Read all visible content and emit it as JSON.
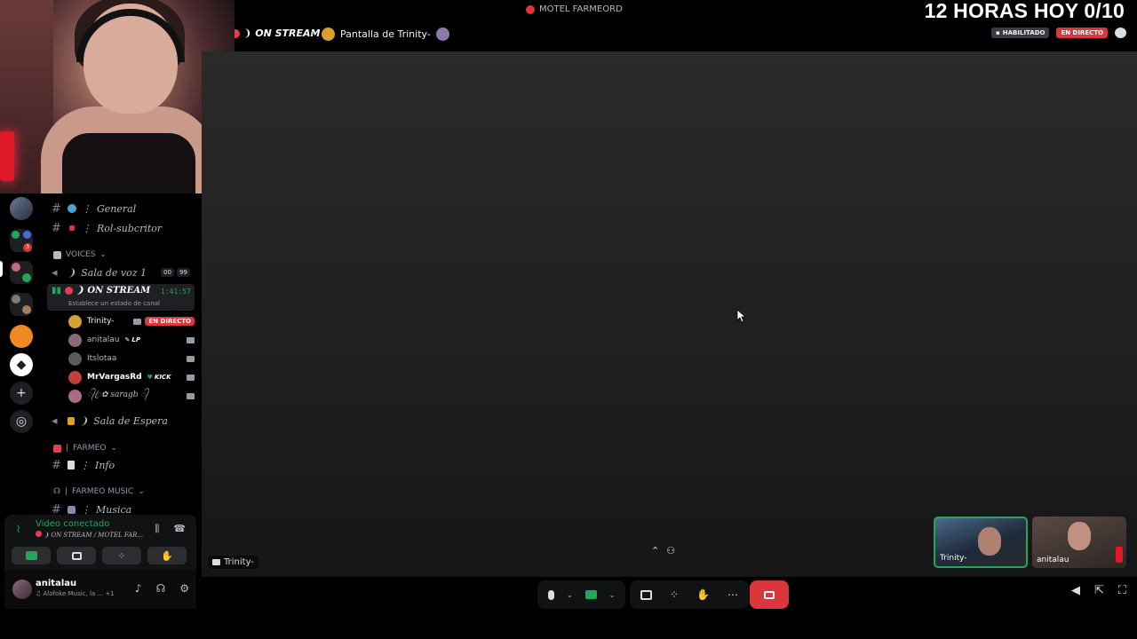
{
  "window": {
    "title": "MOTEL FARMEORD"
  },
  "overlay": {
    "text": "12 HORAS HOY 0/10"
  },
  "stream_header": {
    "channel": "ON STREAM",
    "screen": "Pantalla de Trinity-",
    "badge_hab": "HABILITADO",
    "badge_live": "EN DIRECTO"
  },
  "stage": {
    "label": "Trinity-"
  },
  "tiles": [
    {
      "name": "Trinity-"
    },
    {
      "name": "anitalau"
    }
  ],
  "sidebar": {
    "channels_top": [
      {
        "name": "General",
        "emoji_color": "#4aa3d8"
      },
      {
        "name": "Rol-subcritor",
        "emoji_color": "#e0304a"
      }
    ],
    "voices_category": "VOICES",
    "voice1": {
      "name": "Sala de voz 1",
      "count_a": "00",
      "count_b": "99"
    },
    "active_voice": {
      "name": "ON STREAM",
      "timer": "1:41:57",
      "status": "Establece un estado de canal"
    },
    "members": [
      {
        "name": "Trinity-",
        "badge": "EN DIRECTO",
        "color": "#d8a030"
      },
      {
        "name": "anitalau",
        "tag": "LP",
        "color": "#8a6a7a"
      },
      {
        "name": "Itslotaa",
        "color": "#5a5a5a"
      },
      {
        "name": "MrVargasRd",
        "tag": "KICK",
        "color": "#c04040"
      },
      {
        "name": "᭄ꦿ✿ saragb ᭄",
        "color": "#aa6a8a"
      }
    ],
    "waiting_room": "Sala de Espera",
    "farmeo_category": "FARMEO",
    "info_channel": "Info",
    "farmeo_music_category": "FARMEO MUSIC",
    "music_channel": "Musica"
  },
  "voice_panel": {
    "title": "Video conectado",
    "subtitle": "ON STREAM / MOTEL FAR..."
  },
  "user_panel": {
    "name": "anitalau",
    "status": "Alofoke Music, la ...",
    "extra": "+1"
  },
  "colors": {
    "accent_green": "#23a55a",
    "danger_red": "#da373c"
  }
}
